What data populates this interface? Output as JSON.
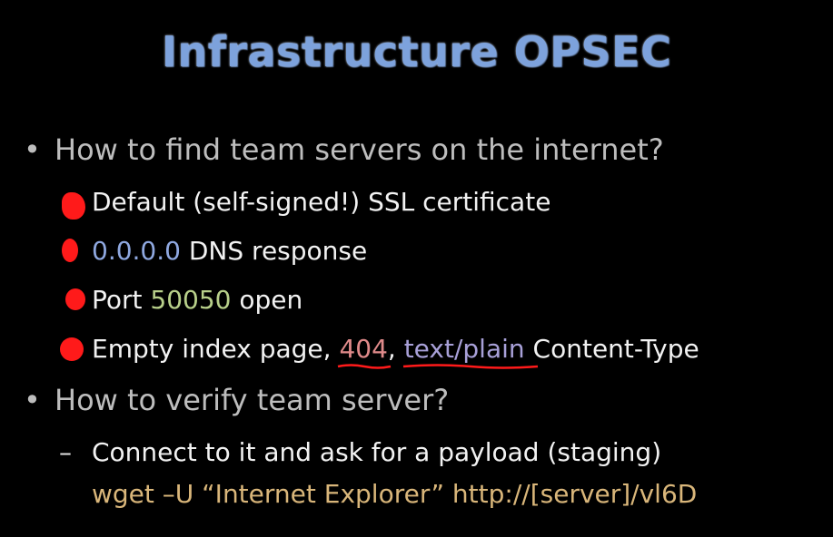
{
  "slide": {
    "title": "Infrastructure OPSEC",
    "bullets": [
      {
        "text": "How to find team servers on the internet?",
        "items": [
          {
            "text": "Default (self-signed!) SSL certificate"
          },
          {
            "highlight": "0.0.0.0",
            "text": " DNS response"
          },
          {
            "pre": "Port ",
            "highlight": "50050",
            "text": " open"
          },
          {
            "pre": "Empty index page, ",
            "highlight": "404",
            "mid": ", ",
            "highlight2": "text/plain",
            "text": " Content-Type"
          }
        ]
      },
      {
        "text": "How to verify team server?",
        "items": [
          {
            "text": "Connect to it and ask for a payload (staging)"
          },
          {
            "text": "wget –U “Internet Explorer” http://[server]/vl6D"
          }
        ]
      }
    ]
  },
  "colors": {
    "title": "#7da2dc",
    "marker": "#ff1a1a",
    "ip": "#8fa8e0",
    "port": "#b8d08a",
    "code": "#d9b67a"
  }
}
